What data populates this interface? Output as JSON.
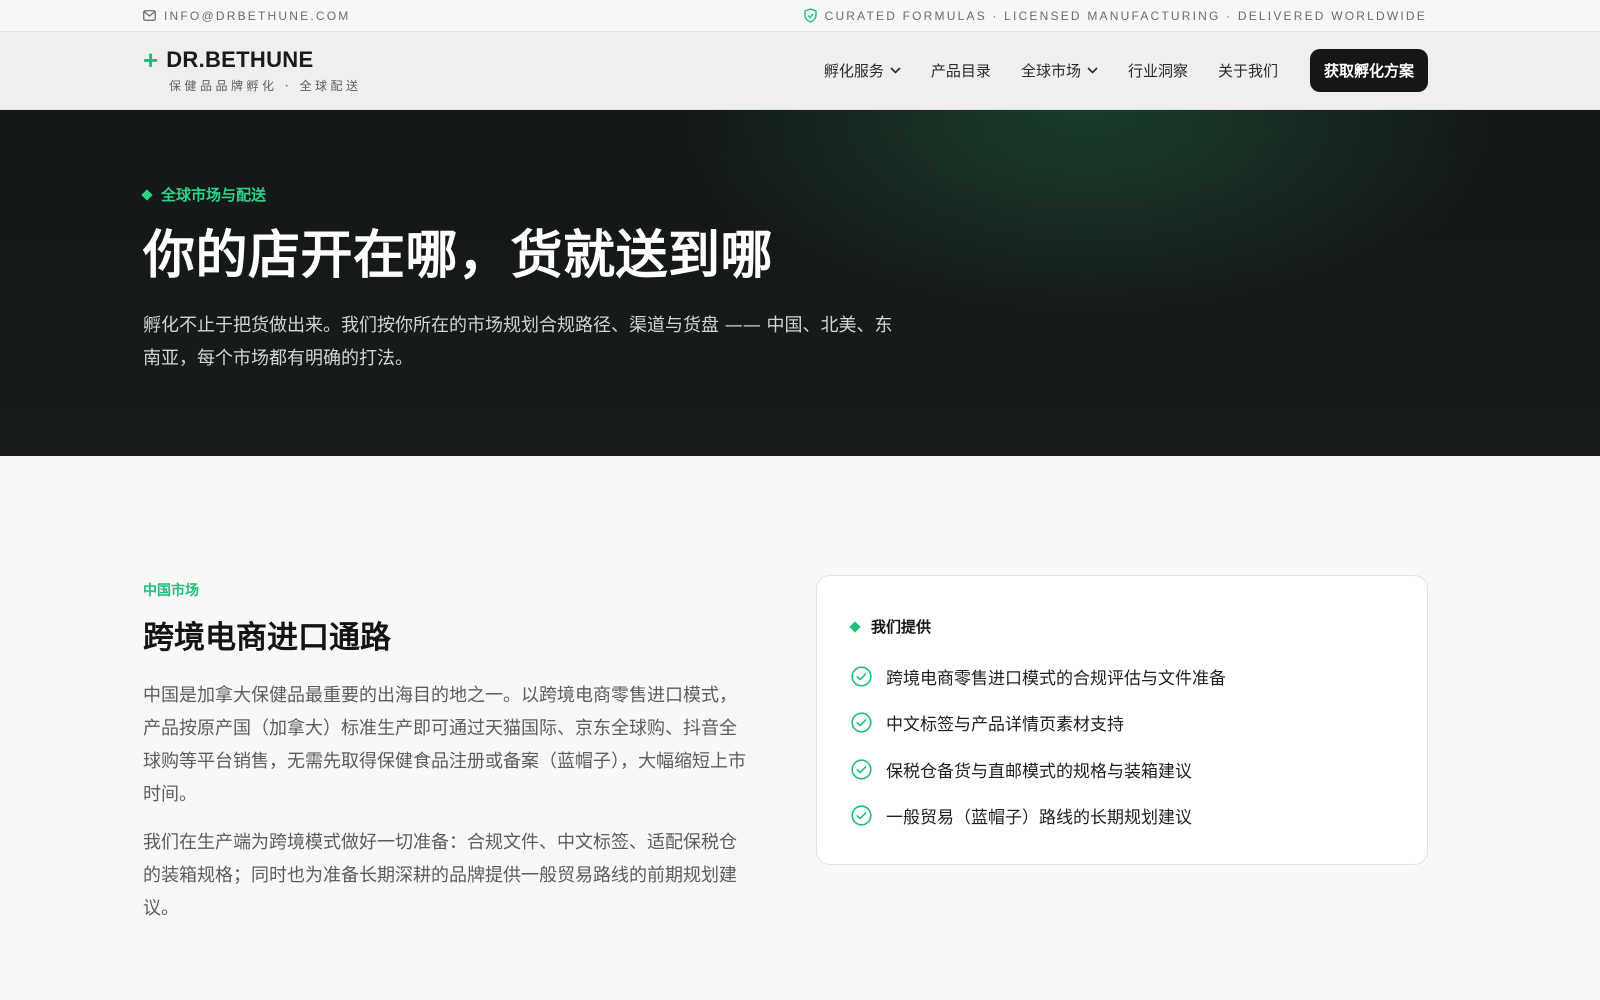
{
  "topbar": {
    "email": "INFO@DRBETHUNE.COM",
    "tagline": "CURATED FORMULAS · LICENSED MANUFACTURING · DELIVERED WORLDWIDE"
  },
  "header": {
    "brand_mark": "+",
    "brand_name": "DR.BETHUNE",
    "brand_tagline": "保健品品牌孵化 · 全球配送",
    "nav": [
      {
        "label": "孵化服务",
        "has_dropdown": true
      },
      {
        "label": "产品目录",
        "has_dropdown": false
      },
      {
        "label": "全球市场",
        "has_dropdown": true
      },
      {
        "label": "行业洞察",
        "has_dropdown": false
      },
      {
        "label": "关于我们",
        "has_dropdown": false
      }
    ],
    "cta_label": "获取孵化方案"
  },
  "hero": {
    "eyebrow": "全球市场与配送",
    "title": "你的店开在哪，货就送到哪",
    "description": "孵化不止于把货做出来。我们按你所在的市场规划合规路径、渠道与货盘 —— 中国、北美、东南亚，每个市场都有明确的打法。"
  },
  "section": {
    "eyebrow": "中国市场",
    "title": "跨境电商进口通路",
    "paragraphs": [
      "中国是加拿大保健品最重要的出海目的地之一。以跨境电商零售进口模式，产品按原产国（加拿大）标准生产即可通过天猫国际、京东全球购、抖音全球购等平台销售，无需先取得保健食品注册或备案（蓝帽子），大幅缩短上市时间。",
      "我们在生产端为跨境模式做好一切准备：合规文件、中文标签、适配保税仓的装箱规格；同时也为准备长期深耕的品牌提供一般贸易路线的前期规划建议。"
    ]
  },
  "card": {
    "title": "我们提供",
    "items": [
      "跨境电商零售进口模式的合规评估与文件准备",
      "中文标签与产品详情页素材支持",
      "保税仓备货与直邮模式的规格与装箱建议",
      "一般贸易（蓝帽子）路线的长期规划建议"
    ]
  },
  "colors": {
    "accent": "#1fbf7a",
    "hero_bg": "#151918",
    "cta_bg": "#161616"
  },
  "icons": {
    "topbar_left": "mail-icon",
    "topbar_right": "shield-check-icon",
    "nav_dropdown": "chevron-down-icon",
    "list_item": "check-circle-icon"
  }
}
